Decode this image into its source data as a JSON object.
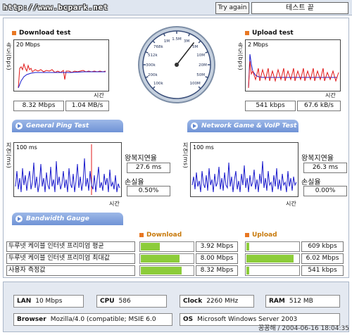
{
  "site": "http://www.bcpark.net",
  "try_again": "Try again",
  "status": "테스트 끝",
  "download": {
    "title": "Download test",
    "ylabel": "속도(bps)",
    "scale": "20 Mbps",
    "xlabel": "시간",
    "kbps": "8.32 Mbps",
    "bytes": "1.04 MB/s"
  },
  "upload": {
    "title": "Upload test",
    "ylabel": "속도(bps)",
    "scale": "2 Mbps",
    "xlabel": "시간",
    "kbps": "541 kbps",
    "bytes": "67.6 kB/s"
  },
  "gauge": {
    "labels": [
      "100k",
      "200k",
      "300k",
      "512k",
      "768k",
      "1M",
      "1.5M",
      "3M",
      "5M",
      "10M",
      "20M",
      "50M",
      "100M"
    ],
    "needle_value_mbps": 8.32
  },
  "ping_tab": "General Ping Test",
  "game_tab": "Network Game & VoIP Test",
  "bandwidth_tab": "Bandwidth Gauge",
  "ping": {
    "ylabel": "지연(ms)",
    "scale": "100 ms",
    "xlabel": "시간",
    "rtt_label": "왕복지연율",
    "rtt": "27.6 ms",
    "loss_label": "손실율",
    "loss": "0.50%"
  },
  "game": {
    "ylabel": "지연(ms)",
    "scale": "100 ms",
    "xlabel": "시간",
    "rtt_label": "왕복지연율",
    "rtt": "26.3 ms",
    "loss_label": "손실율",
    "loss": "0.00%"
  },
  "bandwidth": {
    "download_header": "Download",
    "upload_header": "Upload",
    "rows": [
      {
        "label": "두루넷 케이블 인터넷 프리미엄 평균",
        "down": "3.92 Mbps",
        "down_frac": 0.36,
        "up": "609 kbps",
        "up_frac": 0.05
      },
      {
        "label": "두루넷 케이블 인터넷 프리미엄 최대값",
        "down": "8.00 Mbps",
        "down_frac": 0.72,
        "up": "6.02 Mbps",
        "up_frac": 0.88
      },
      {
        "label": "사용자 측정값",
        "down": "8.32 Mbps",
        "down_frac": 0.76,
        "up": "541 kbps",
        "up_frac": 0.05
      }
    ]
  },
  "system": {
    "lan_label": "LAN",
    "lan": "10 Mbps",
    "cpu_label": "CPU",
    "cpu": "586",
    "clock_label": "Clock",
    "clock": "2260 MHz",
    "ram_label": "RAM",
    "ram": "512 MB",
    "browser_label": "Browser",
    "browser": "Mozilla/4.0 (compatible; MSIE 6.0",
    "os_label": "OS",
    "os": "Microsoft Windows Server 2003"
  },
  "footer": "꽁꽁해 / 2004-06-16 18:04:35",
  "colors": {
    "accent": "#e87722",
    "tab": "#6f93d6",
    "bar": "#8ccc3a"
  }
}
